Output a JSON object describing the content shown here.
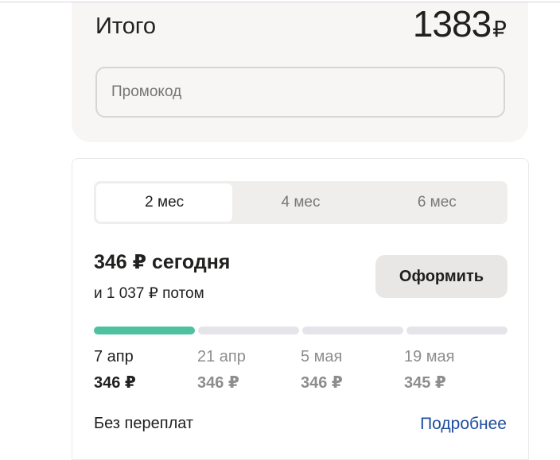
{
  "total": {
    "label": "Итого",
    "value": "1383",
    "currency": "₽",
    "promo_placeholder": "Промокод"
  },
  "split": {
    "tabs": [
      {
        "label": "2 мес",
        "active": true
      },
      {
        "label": "4 мес"
      },
      {
        "label": "6 мес"
      }
    ],
    "today": "346 ₽ сегодня",
    "later": "и 1 037 ₽ потом",
    "checkout_label": "Оформить",
    "progress_paid_parts": 1,
    "payments": [
      {
        "date": "7 апр",
        "amount": "346 ₽"
      },
      {
        "date": "21 апр",
        "amount": "346 ₽"
      },
      {
        "date": "5 мая",
        "amount": "346 ₽"
      },
      {
        "date": "19 мая",
        "amount": "345 ₽"
      }
    ],
    "no_overpay": "Без переплат",
    "more_link": "Подробнее"
  },
  "colors": {
    "accent": "#4dc1a0",
    "link": "#1f4fa0"
  }
}
